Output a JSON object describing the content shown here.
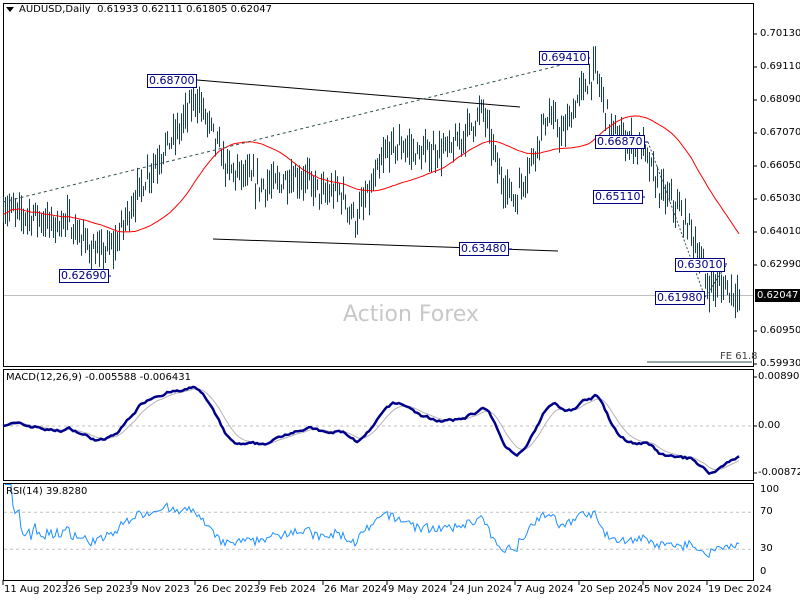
{
  "header": {
    "symbol": "AUDUSD,Daily",
    "ohlc": "0.61933 0.62111 0.61805 0.62047",
    "menu_icon": "triangle-down-icon"
  },
  "watermark": "Action Forex",
  "macd": {
    "label": "MACD(12,26,9) -0.005588 -0.006431",
    "axis": [
      "0.008901",
      "0.00",
      "-0.008729"
    ],
    "main_color": "#00008b",
    "signal_color": "#b4b4b4"
  },
  "rsi": {
    "label": "RSI(14) 39.8280",
    "axis": [
      "100",
      "70",
      "30",
      "0"
    ],
    "color": "#1e90ff"
  },
  "price_axis": [
    "0.70130",
    "0.69110",
    "0.68090",
    "0.67070",
    "0.66050",
    "0.65030",
    "0.64010",
    "0.62990",
    "0.60950",
    "0.59930"
  ],
  "current_price": "0.62047",
  "annotations": {
    "high_2023": "0.68700",
    "low_2023": "0.62690",
    "low_aug": "0.63480",
    "high_sep": "0.69410",
    "level_a": "0.66870",
    "level_b": "0.65110",
    "level_c": "0.63010",
    "level_d": "0.61980",
    "fe": "FE 61.8"
  },
  "date_axis": [
    "11 Aug 2023",
    "26 Sep 2023",
    "9 Nov 2023",
    "26 Dec 2023",
    "9 Feb 2024",
    "26 Mar 2024",
    "9 May 2024",
    "24 Jun 2024",
    "7 Aug 2024",
    "20 Sep 2024",
    "5 Nov 2024",
    "19 Dec 2024"
  ],
  "colors": {
    "bars": "#173f57",
    "ma": "#ff0000",
    "grid_dash": "#c0c0c0"
  },
  "chart_data": {
    "type": "ohlc",
    "title": "AUDUSD,Daily",
    "timeframe": "Daily",
    "x_range": [
      "11 Aug 2023",
      "Jan 2025"
    ],
    "ylim": [
      0.5993,
      0.7065
    ],
    "approx_price_path_every_8_bars": [
      0.6484,
      0.6454,
      0.6454,
      0.6423,
      0.6438,
      0.6376,
      0.633,
      0.6361,
      0.6484,
      0.6577,
      0.6654,
      0.6716,
      0.6824,
      0.6716,
      0.6593,
      0.6577,
      0.6546,
      0.6546,
      0.6577,
      0.6562,
      0.6515,
      0.6531,
      0.6438,
      0.6531,
      0.6654,
      0.667,
      0.6639,
      0.6654,
      0.6654,
      0.6716,
      0.6778,
      0.6577,
      0.65,
      0.6624,
      0.6763,
      0.6701,
      0.6824,
      0.6902,
      0.6716,
      0.6685,
      0.6654,
      0.6531,
      0.6484,
      0.6407,
      0.6237,
      0.6237,
      0.6205
    ],
    "last": {
      "open": 0.61933,
      "high": 0.62111,
      "low": 0.61805,
      "close": 0.62047
    },
    "overlays": [
      "moving average (red)",
      "trendlines",
      "Fibonacci expansion FE 61.8"
    ],
    "indicators": [
      "MACD(12,26,9)",
      "RSI(14)"
    ],
    "rsi_levels": [
      30,
      70
    ],
    "grid": false
  }
}
